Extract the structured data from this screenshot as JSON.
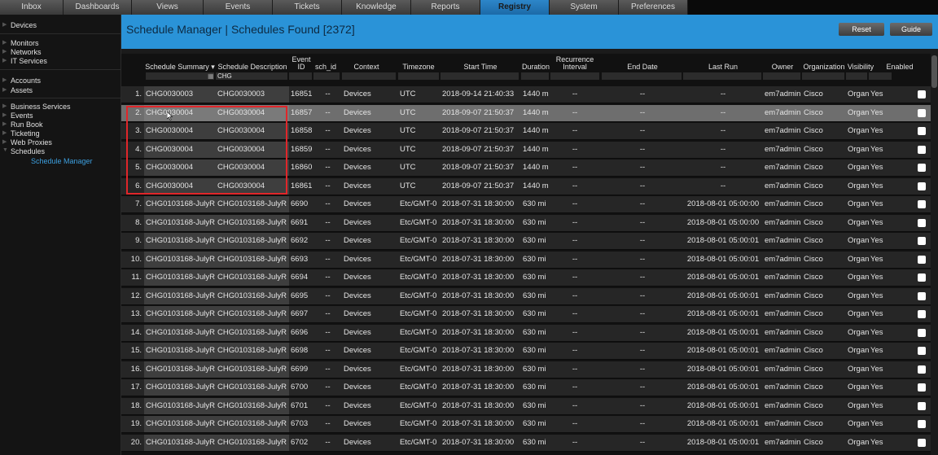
{
  "nav": {
    "tabs": [
      "Inbox",
      "Dashboards",
      "Views",
      "Events",
      "Tickets",
      "Knowledge",
      "Reports",
      "Registry",
      "System",
      "Preferences"
    ],
    "active": "Registry"
  },
  "sidebar": {
    "items": [
      "Devices",
      "Monitors",
      "Networks",
      "IT Services",
      "Accounts",
      "Assets",
      "Business Services",
      "Events",
      "Run Book",
      "Ticketing",
      "Web Proxies",
      "Schedules",
      "Schedule Manager"
    ]
  },
  "header": {
    "title": "Schedule Manager | Schedules Found [2372]",
    "reset_label": "Reset",
    "guide_label": "Guide"
  },
  "columns": {
    "summary": "Schedule Summary ▾",
    "description": "Schedule Description",
    "event_id": "Event ID",
    "sch_id": "sch_id",
    "context": "Context",
    "timezone": "Timezone",
    "start_time": "Start Time",
    "duration": "Duration",
    "recurrence": "Recurrence Interval",
    "end_date": "End Date",
    "last_run": "Last Run",
    "owner": "Owner",
    "organization": "Organization",
    "visibility": "Visibility",
    "enabled": "Enabled"
  },
  "filter": {
    "description_value": "CHG"
  },
  "rows": [
    {
      "idx": "1.",
      "summary": "CHG0030003",
      "description": "CHG0030003",
      "event_id": "16851",
      "sch_id": "--",
      "context": "Devices",
      "timezone": "UTC",
      "start": "2018-09-14 21:40:33",
      "duration": "1440 m",
      "recurrence": "--",
      "end_date": "--",
      "last_run": "--",
      "owner": "em7admin",
      "org": "Cisco",
      "visibility": "Organi:",
      "enabled": "Yes"
    },
    {
      "idx": "2.",
      "summary": "CHG0030004",
      "description": "CHG0030004",
      "event_id": "16857",
      "sch_id": "--",
      "context": "Devices",
      "timezone": "UTC",
      "start": "2018-09-07 21:50:37",
      "duration": "1440 m",
      "recurrence": "--",
      "end_date": "--",
      "last_run": "--",
      "owner": "em7admin",
      "org": "Cisco",
      "visibility": "Organi:",
      "enabled": "Yes"
    },
    {
      "idx": "3.",
      "summary": "CHG0030004",
      "description": "CHG0030004",
      "event_id": "16858",
      "sch_id": "--",
      "context": "Devices",
      "timezone": "UTC",
      "start": "2018-09-07 21:50:37",
      "duration": "1440 m",
      "recurrence": "--",
      "end_date": "--",
      "last_run": "--",
      "owner": "em7admin",
      "org": "Cisco",
      "visibility": "Organi:",
      "enabled": "Yes"
    },
    {
      "idx": "4.",
      "summary": "CHG0030004",
      "description": "CHG0030004",
      "event_id": "16859",
      "sch_id": "--",
      "context": "Devices",
      "timezone": "UTC",
      "start": "2018-09-07 21:50:37",
      "duration": "1440 m",
      "recurrence": "--",
      "end_date": "--",
      "last_run": "--",
      "owner": "em7admin",
      "org": "Cisco",
      "visibility": "Organi:",
      "enabled": "Yes"
    },
    {
      "idx": "5.",
      "summary": "CHG0030004",
      "description": "CHG0030004",
      "event_id": "16860",
      "sch_id": "--",
      "context": "Devices",
      "timezone": "UTC",
      "start": "2018-09-07 21:50:37",
      "duration": "1440 m",
      "recurrence": "--",
      "end_date": "--",
      "last_run": "--",
      "owner": "em7admin",
      "org": "Cisco",
      "visibility": "Organi:",
      "enabled": "Yes"
    },
    {
      "idx": "6.",
      "summary": "CHG0030004",
      "description": "CHG0030004",
      "event_id": "16861",
      "sch_id": "--",
      "context": "Devices",
      "timezone": "UTC",
      "start": "2018-09-07 21:50:37",
      "duration": "1440 m",
      "recurrence": "--",
      "end_date": "--",
      "last_run": "--",
      "owner": "em7admin",
      "org": "Cisco",
      "visibility": "Organi:",
      "enabled": "Yes"
    },
    {
      "idx": "7.",
      "summary": "CHG0103168-JulyR",
      "description": "CHG0103168-JulyR",
      "event_id": "6690",
      "sch_id": "--",
      "context": "Devices",
      "timezone": "Etc/GMT-0",
      "start": "2018-07-31 18:30:00",
      "duration": "630 mi",
      "recurrence": "--",
      "end_date": "--",
      "last_run": "2018-08-01 05:00:00",
      "owner": "em7admin",
      "org": "Cisco",
      "visibility": "Organi:",
      "enabled": "Yes"
    },
    {
      "idx": "8.",
      "summary": "CHG0103168-JulyR",
      "description": "CHG0103168-JulyR",
      "event_id": "6691",
      "sch_id": "--",
      "context": "Devices",
      "timezone": "Etc/GMT-0",
      "start": "2018-07-31 18:30:00",
      "duration": "630 mi",
      "recurrence": "--",
      "end_date": "--",
      "last_run": "2018-08-01 05:00:00",
      "owner": "em7admin",
      "org": "Cisco",
      "visibility": "Organi:",
      "enabled": "Yes"
    },
    {
      "idx": "9.",
      "summary": "CHG0103168-JulyR",
      "description": "CHG0103168-JulyR",
      "event_id": "6692",
      "sch_id": "--",
      "context": "Devices",
      "timezone": "Etc/GMT-0",
      "start": "2018-07-31 18:30:00",
      "duration": "630 mi",
      "recurrence": "--",
      "end_date": "--",
      "last_run": "2018-08-01 05:00:01",
      "owner": "em7admin",
      "org": "Cisco",
      "visibility": "Organi:",
      "enabled": "Yes"
    },
    {
      "idx": "10.",
      "summary": "CHG0103168-JulyR",
      "description": "CHG0103168-JulyR",
      "event_id": "6693",
      "sch_id": "--",
      "context": "Devices",
      "timezone": "Etc/GMT-0",
      "start": "2018-07-31 18:30:00",
      "duration": "630 mi",
      "recurrence": "--",
      "end_date": "--",
      "last_run": "2018-08-01 05:00:01",
      "owner": "em7admin",
      "org": "Cisco",
      "visibility": "Organi:",
      "enabled": "Yes"
    },
    {
      "idx": "11.",
      "summary": "CHG0103168-JulyR",
      "description": "CHG0103168-JulyR",
      "event_id": "6694",
      "sch_id": "--",
      "context": "Devices",
      "timezone": "Etc/GMT-0",
      "start": "2018-07-31 18:30:00",
      "duration": "630 mi",
      "recurrence": "--",
      "end_date": "--",
      "last_run": "2018-08-01 05:00:01",
      "owner": "em7admin",
      "org": "Cisco",
      "visibility": "Organi:",
      "enabled": "Yes"
    },
    {
      "idx": "12.",
      "summary": "CHG0103168-JulyR",
      "description": "CHG0103168-JulyR",
      "event_id": "6695",
      "sch_id": "--",
      "context": "Devices",
      "timezone": "Etc/GMT-0",
      "start": "2018-07-31 18:30:00",
      "duration": "630 mi",
      "recurrence": "--",
      "end_date": "--",
      "last_run": "2018-08-01 05:00:01",
      "owner": "em7admin",
      "org": "Cisco",
      "visibility": "Organi:",
      "enabled": "Yes"
    },
    {
      "idx": "13.",
      "summary": "CHG0103168-JulyR",
      "description": "CHG0103168-JulyR",
      "event_id": "6697",
      "sch_id": "--",
      "context": "Devices",
      "timezone": "Etc/GMT-0",
      "start": "2018-07-31 18:30:00",
      "duration": "630 mi",
      "recurrence": "--",
      "end_date": "--",
      "last_run": "2018-08-01 05:00:01",
      "owner": "em7admin",
      "org": "Cisco",
      "visibility": "Organi:",
      "enabled": "Yes"
    },
    {
      "idx": "14.",
      "summary": "CHG0103168-JulyR",
      "description": "CHG0103168-JulyR",
      "event_id": "6696",
      "sch_id": "--",
      "context": "Devices",
      "timezone": "Etc/GMT-0",
      "start": "2018-07-31 18:30:00",
      "duration": "630 mi",
      "recurrence": "--",
      "end_date": "--",
      "last_run": "2018-08-01 05:00:01",
      "owner": "em7admin",
      "org": "Cisco",
      "visibility": "Organi:",
      "enabled": "Yes"
    },
    {
      "idx": "15.",
      "summary": "CHG0103168-JulyR",
      "description": "CHG0103168-JulyR",
      "event_id": "6698",
      "sch_id": "--",
      "context": "Devices",
      "timezone": "Etc/GMT-0",
      "start": "2018-07-31 18:30:00",
      "duration": "630 mi",
      "recurrence": "--",
      "end_date": "--",
      "last_run": "2018-08-01 05:00:01",
      "owner": "em7admin",
      "org": "Cisco",
      "visibility": "Organi:",
      "enabled": "Yes"
    },
    {
      "idx": "16.",
      "summary": "CHG0103168-JulyR",
      "description": "CHG0103168-JulyR",
      "event_id": "6699",
      "sch_id": "--",
      "context": "Devices",
      "timezone": "Etc/GMT-0",
      "start": "2018-07-31 18:30:00",
      "duration": "630 mi",
      "recurrence": "--",
      "end_date": "--",
      "last_run": "2018-08-01 05:00:01",
      "owner": "em7admin",
      "org": "Cisco",
      "visibility": "Organi:",
      "enabled": "Yes"
    },
    {
      "idx": "17.",
      "summary": "CHG0103168-JulyR",
      "description": "CHG0103168-JulyR",
      "event_id": "6700",
      "sch_id": "--",
      "context": "Devices",
      "timezone": "Etc/GMT-0",
      "start": "2018-07-31 18:30:00",
      "duration": "630 mi",
      "recurrence": "--",
      "end_date": "--",
      "last_run": "2018-08-01 05:00:01",
      "owner": "em7admin",
      "org": "Cisco",
      "visibility": "Organi:",
      "enabled": "Yes"
    },
    {
      "idx": "18.",
      "summary": "CHG0103168-JulyR",
      "description": "CHG0103168-JulyR",
      "event_id": "6701",
      "sch_id": "--",
      "context": "Devices",
      "timezone": "Etc/GMT-0",
      "start": "2018-07-31 18:30:00",
      "duration": "630 mi",
      "recurrence": "--",
      "end_date": "--",
      "last_run": "2018-08-01 05:00:01",
      "owner": "em7admin",
      "org": "Cisco",
      "visibility": "Organi:",
      "enabled": "Yes"
    },
    {
      "idx": "19.",
      "summary": "CHG0103168-JulyR",
      "description": "CHG0103168-JulyR",
      "event_id": "6703",
      "sch_id": "--",
      "context": "Devices",
      "timezone": "Etc/GMT-0",
      "start": "2018-07-31 18:30:00",
      "duration": "630 mi",
      "recurrence": "--",
      "end_date": "--",
      "last_run": "2018-08-01 05:00:01",
      "owner": "em7admin",
      "org": "Cisco",
      "visibility": "Organi:",
      "enabled": "Yes"
    },
    {
      "idx": "20.",
      "summary": "CHG0103168-JulyR",
      "description": "CHG0103168-JulyR",
      "event_id": "6702",
      "sch_id": "--",
      "context": "Devices",
      "timezone": "Etc/GMT-0",
      "start": "2018-07-31 18:30:00",
      "duration": "630 mi",
      "recurrence": "--",
      "end_date": "--",
      "last_run": "2018-08-01 05:00:01",
      "owner": "em7admin",
      "org": "Cisco",
      "visibility": "Organi:",
      "enabled": "Yes"
    }
  ],
  "selected_row": 2,
  "colors": {
    "accent": "#2a93d8",
    "highlight_box": "#e0262a",
    "selected_row": "#6e6e6e"
  }
}
